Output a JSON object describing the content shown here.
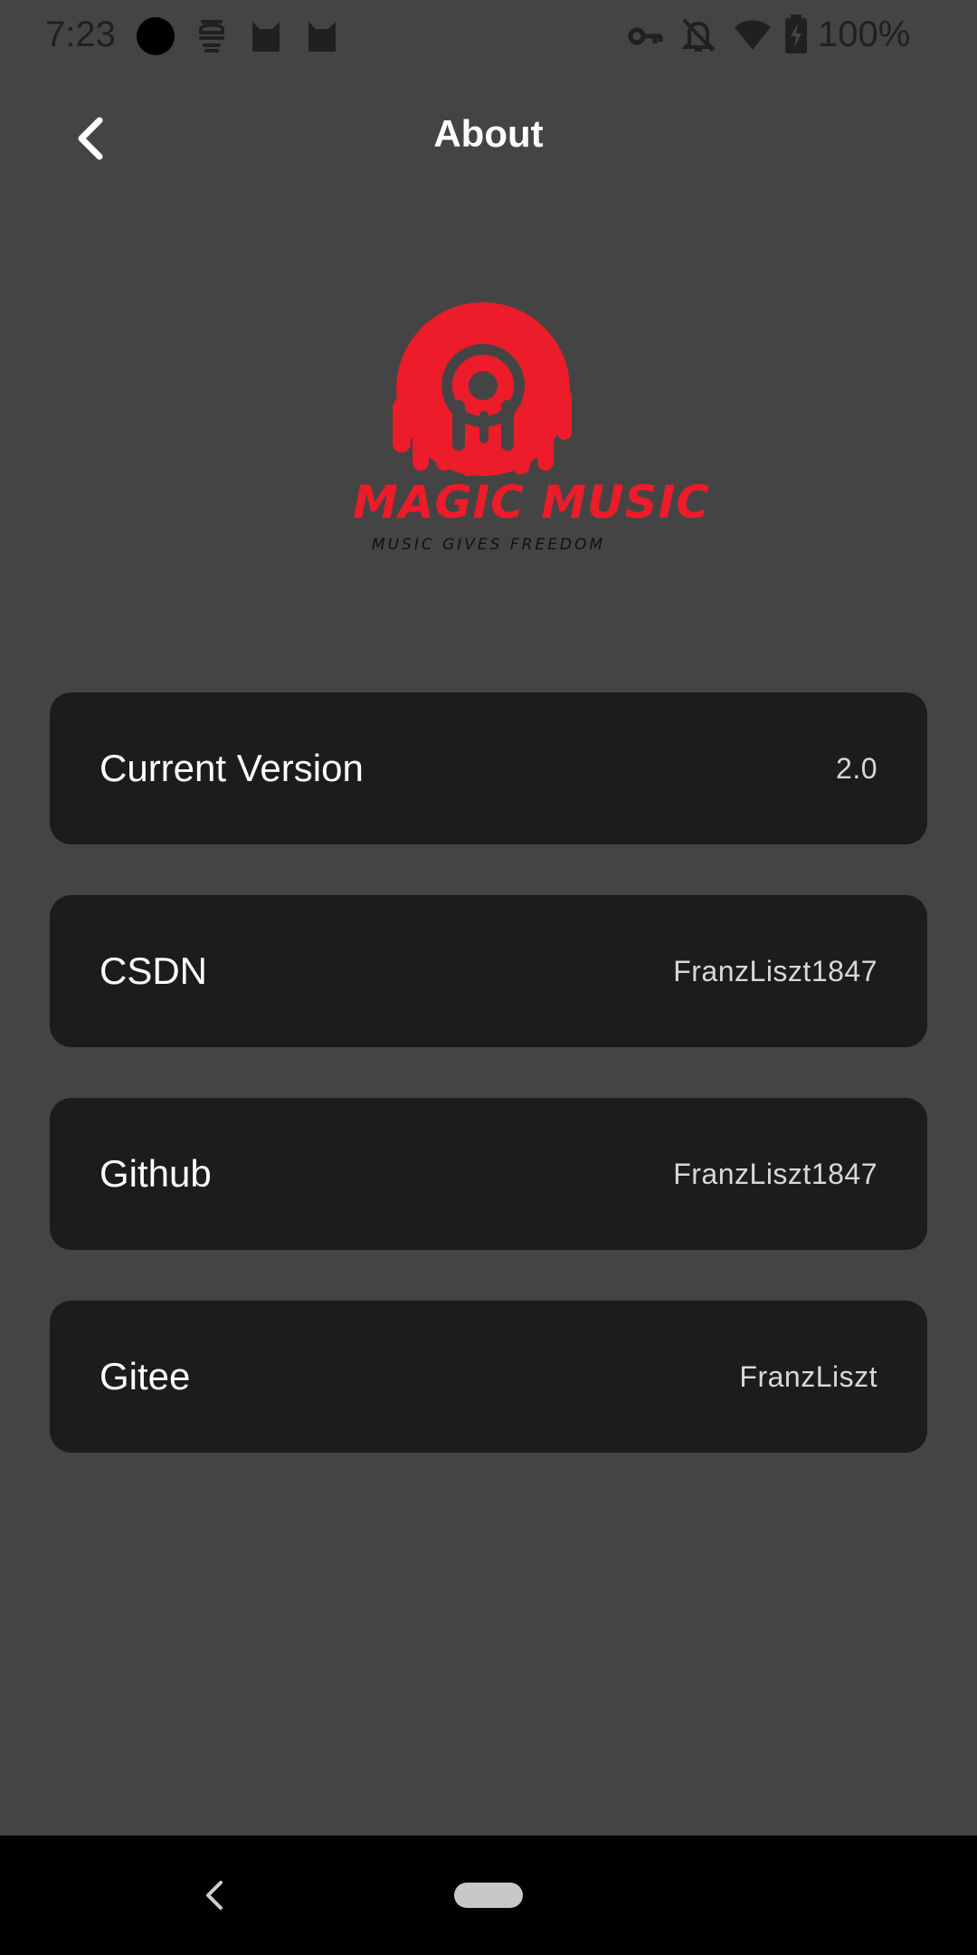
{
  "status_bar": {
    "time": "7:23",
    "battery_percent": "100%",
    "icons": [
      "record-dot-icon",
      "sim-icon",
      "cat-icon",
      "cat-icon",
      "vpn-key-icon",
      "notifications-off-icon",
      "wifi-icon",
      "battery-charging-icon"
    ]
  },
  "header": {
    "title": "About",
    "back_icon": "chevron-left-icon"
  },
  "logo": {
    "brand": "MAGIC MUSIC",
    "tagline": "MUSIC GIVES FREEDOM",
    "color": "#ec1c2b"
  },
  "info_items": [
    {
      "label": "Current Version",
      "value": "2.0"
    },
    {
      "label": "CSDN",
      "value": "FranzLiszt1847"
    },
    {
      "label": "Github",
      "value": "FranzLiszt1847"
    },
    {
      "label": "Gitee",
      "value": "FranzLiszt"
    }
  ],
  "nav_bar": {
    "back_icon": "nav-back-icon",
    "home_icon": "home-pill-icon"
  },
  "colors": {
    "background": "#444444",
    "card": "#1c1c1c",
    "accent": "#ec1c2b"
  }
}
